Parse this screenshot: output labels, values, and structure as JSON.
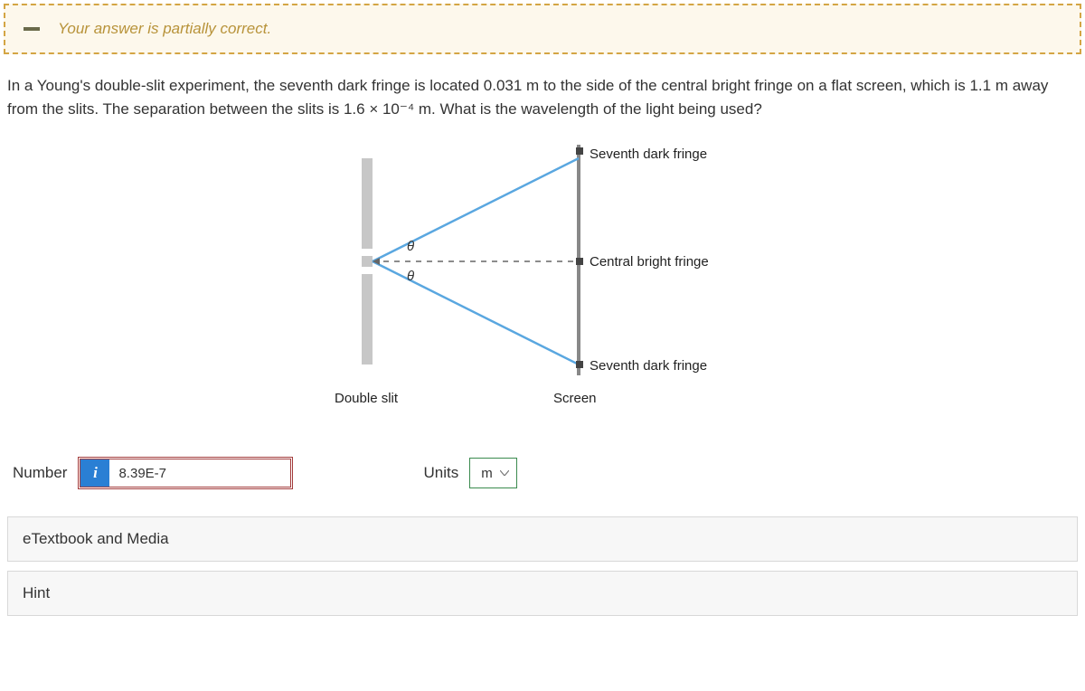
{
  "feedback": {
    "message": "Your answer is partially correct."
  },
  "question": {
    "text": "In a Young's double-slit experiment, the seventh dark fringe is located 0.031 m to the side of the central bright fringe on a flat screen, which is 1.1 m away from the slits. The separation between the slits is 1.6 × 10⁻⁴ m. What is the wavelength of the light being used?"
  },
  "diagram": {
    "top_label": "Seventh dark fringe",
    "center_label": "Central bright fringe",
    "bottom_label": "Seventh dark fringe",
    "slit_label": "Double slit",
    "screen_label": "Screen",
    "theta_top": "θ",
    "theta_bottom": "θ"
  },
  "answer": {
    "number_label": "Number",
    "number_value": "8.39E-7",
    "info_badge": "i",
    "units_label": "Units",
    "units_selected": "m"
  },
  "accordions": {
    "etextbook": "eTextbook and Media",
    "hint": "Hint"
  }
}
